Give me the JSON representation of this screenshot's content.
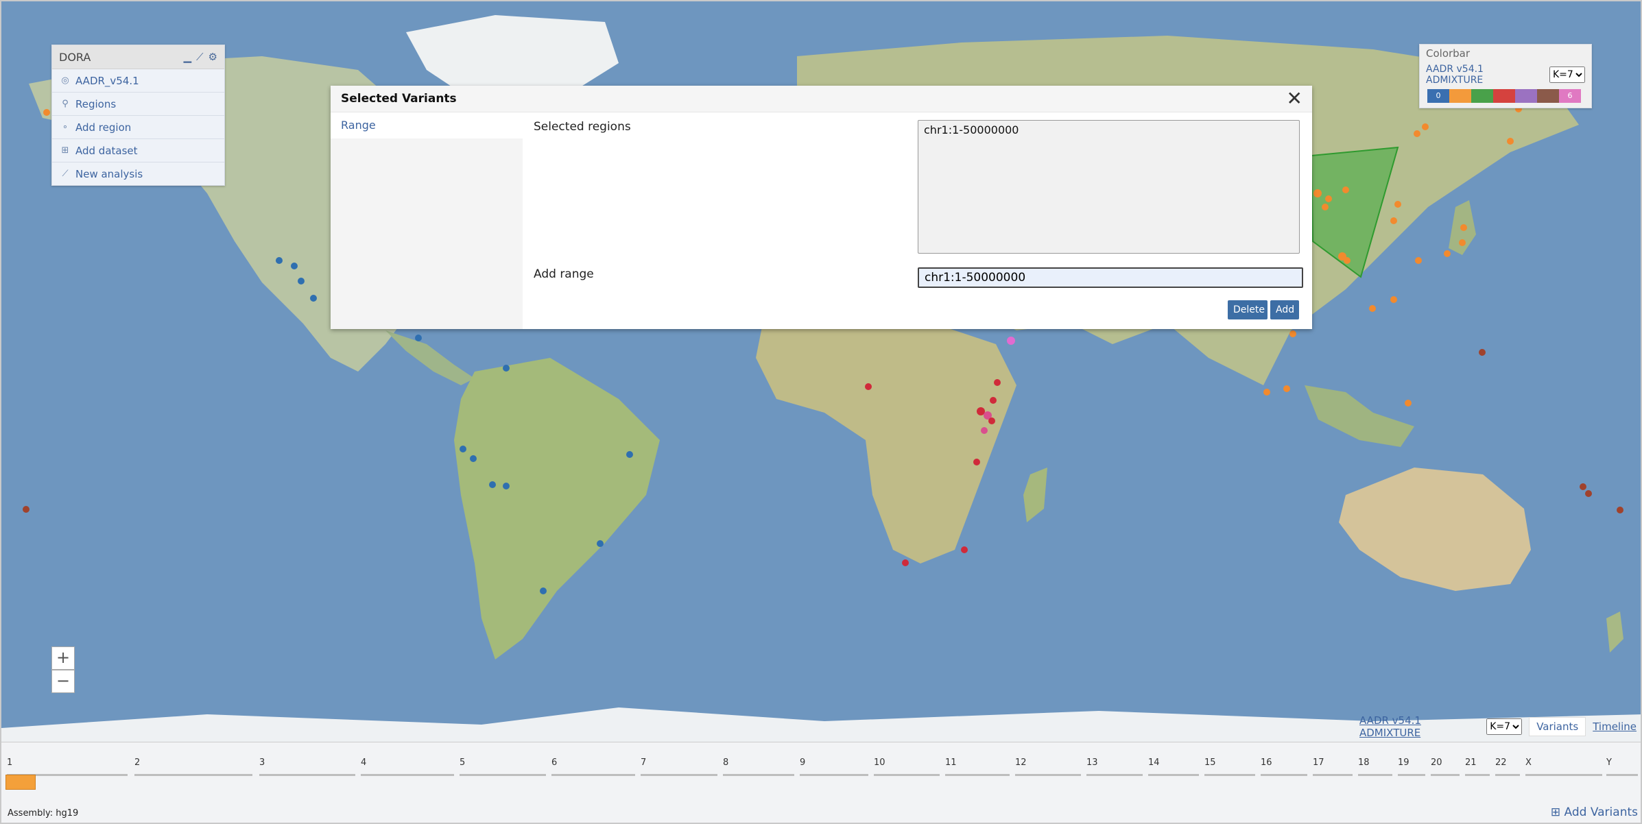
{
  "sidebar": {
    "title": "DORA",
    "icons": [
      "minimize-icon",
      "chart-icon",
      "gear-icon"
    ],
    "items": [
      {
        "label": "AADR_v54.1",
        "icon": "layers-icon"
      },
      {
        "label": "Regions",
        "icon": "pin-icon"
      },
      {
        "label": "Add region",
        "icon": "node-icon"
      },
      {
        "label": "Add dataset",
        "icon": "plus-box-icon"
      },
      {
        "label": "New analysis",
        "icon": "line-chart-icon"
      }
    ]
  },
  "colorbar": {
    "title": "Colorbar",
    "dataset": "AADR v54.1 ADMIXTURE",
    "k_value": "K=7",
    "first_label": "0",
    "last_label": "6",
    "colors": [
      "#3a6fb0",
      "#f39a3b",
      "#49a14a",
      "#d5423e",
      "#9b72c1",
      "#8b5a4a",
      "#e079c2"
    ]
  },
  "modal": {
    "title": "Selected Variants",
    "tab": "Range",
    "selected_regions_label": "Selected regions",
    "selected_regions_value": "chr1:1-50000000",
    "add_range_label": "Add range",
    "add_range_value": "chr1:1-50000000",
    "delete_label": "Delete",
    "add_label": "Add"
  },
  "zoom": {
    "in": "+",
    "out": "−"
  },
  "bottom": {
    "dataset": "AADR v54.1 ADMIXTURE",
    "k_value": "K=7",
    "tab_variants": "Variants",
    "tab_timeline": "Timeline"
  },
  "chromosomes": [
    "1",
    "2",
    "3",
    "4",
    "5",
    "6",
    "7",
    "8",
    "9",
    "10",
    "11",
    "12",
    "13",
    "14",
    "15",
    "16",
    "17",
    "18",
    "19",
    "20",
    "21",
    "22",
    "X",
    "Y"
  ],
  "selected_chromosome": "1",
  "assembly": "Assembly: hg19",
  "add_variants": "Add Variants"
}
